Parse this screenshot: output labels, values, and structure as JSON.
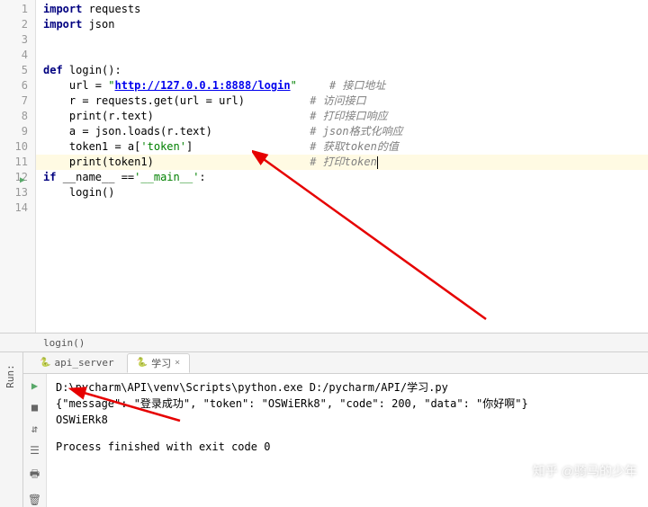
{
  "code": {
    "lines": [
      {
        "n": "1",
        "indent": "",
        "tokens": [
          {
            "t": "import ",
            "c": "kw"
          },
          {
            "t": "requests",
            "c": ""
          }
        ]
      },
      {
        "n": "2",
        "indent": "",
        "tokens": [
          {
            "t": "import ",
            "c": "kw"
          },
          {
            "t": "json",
            "c": ""
          }
        ]
      },
      {
        "n": "3",
        "indent": "",
        "tokens": []
      },
      {
        "n": "4",
        "indent": "",
        "tokens": []
      },
      {
        "n": "5",
        "indent": "",
        "tokens": [
          {
            "t": "def ",
            "c": "kw"
          },
          {
            "t": "login():",
            "c": ""
          }
        ]
      },
      {
        "n": "6",
        "indent": "    ",
        "tokens": [
          {
            "t": "url = ",
            "c": ""
          },
          {
            "t": "\"",
            "c": "str"
          },
          {
            "t": "http://127.0.0.1:8888/login",
            "c": "link"
          },
          {
            "t": "\"",
            "c": "str"
          },
          {
            "t": "     ",
            "c": ""
          },
          {
            "t": "# 接口地址",
            "c": "comment"
          }
        ]
      },
      {
        "n": "7",
        "indent": "    ",
        "tokens": [
          {
            "t": "r = requests.get(url = url)",
            "c": ""
          },
          {
            "t": "          ",
            "c": ""
          },
          {
            "t": "# 访问接口",
            "c": "comment"
          }
        ]
      },
      {
        "n": "8",
        "indent": "    ",
        "tokens": [
          {
            "t": "print",
            "c": ""
          },
          {
            "t": "(r.text)",
            "c": ""
          },
          {
            "t": "                        ",
            "c": ""
          },
          {
            "t": "# 打印接口响应",
            "c": "comment"
          }
        ]
      },
      {
        "n": "9",
        "indent": "    ",
        "tokens": [
          {
            "t": "a = json.loads(r.text)",
            "c": ""
          },
          {
            "t": "               ",
            "c": ""
          },
          {
            "t": "# json格式化响应",
            "c": "comment"
          }
        ]
      },
      {
        "n": "10",
        "indent": "    ",
        "tokens": [
          {
            "t": "token1 = a[",
            "c": ""
          },
          {
            "t": "'token'",
            "c": "str"
          },
          {
            "t": "]",
            "c": ""
          },
          {
            "t": "                  ",
            "c": ""
          },
          {
            "t": "# 获取token的值",
            "c": "comment"
          }
        ]
      },
      {
        "n": "11",
        "indent": "    ",
        "tokens": [
          {
            "t": "print",
            "c": ""
          },
          {
            "t": "(token1)",
            "c": ""
          },
          {
            "t": "                        ",
            "c": ""
          },
          {
            "t": "# 打印",
            "c": "comment"
          },
          {
            "t": "token",
            "c": "comment"
          }
        ],
        "hl": true,
        "cursor": true
      },
      {
        "n": "12",
        "indent": "",
        "tokens": [
          {
            "t": "if ",
            "c": "kw"
          },
          {
            "t": "__name__ ==",
            "c": ""
          },
          {
            "t": "'__main__'",
            "c": "str"
          },
          {
            "t": ":",
            "c": ""
          }
        ],
        "run": true
      },
      {
        "n": "13",
        "indent": "    ",
        "tokens": [
          {
            "t": "login()",
            "c": ""
          }
        ]
      },
      {
        "n": "14",
        "indent": "",
        "tokens": []
      }
    ]
  },
  "breadcrumb": "login()",
  "run": {
    "label": "Run:",
    "tabs": [
      {
        "name": "api_server",
        "active": false
      },
      {
        "name": "学习",
        "active": true
      }
    ],
    "output": {
      "path": "D:\\pycharm\\API\\venv\\Scripts\\python.exe D:/pycharm/API/学习.py",
      "json_line": "{\"message\": \"登录成功\", \"token\": \"OSWiERk8\", \"code\": 200, \"data\": \"你好啊\"}",
      "token": "OSWiERk8",
      "exit": "Process finished with exit code 0"
    }
  },
  "watermark": "知乎 @骑马的少年"
}
